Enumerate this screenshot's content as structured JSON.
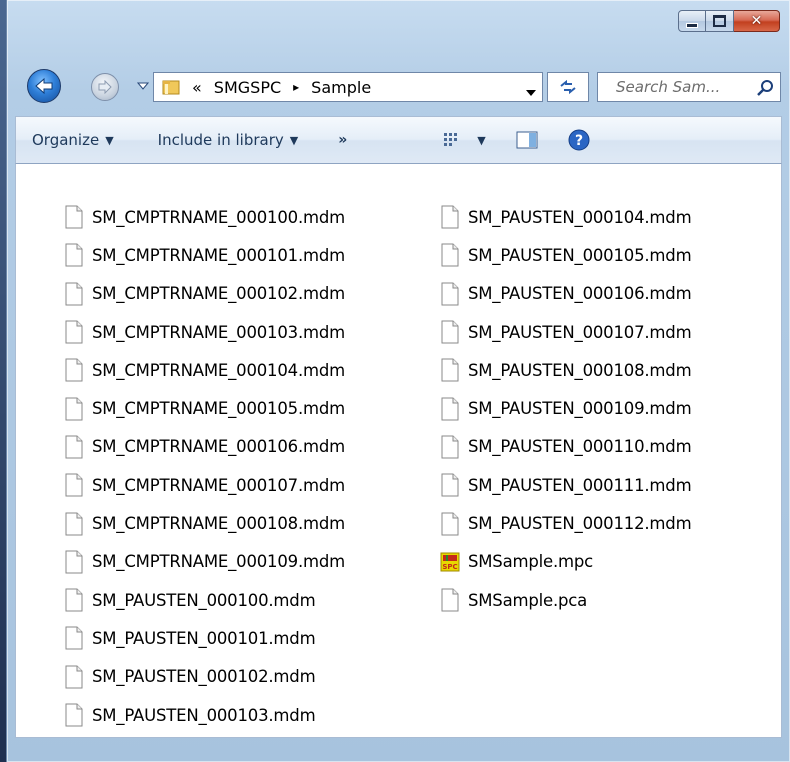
{
  "window": {
    "caption_buttons": {
      "minimize": "minimize-icon",
      "maximize": "maximize-icon",
      "close": "close-icon"
    },
    "close_color": "#c2401f"
  },
  "address_bar": {
    "chevron": "«",
    "crumbs": [
      "SMGSPC",
      "Sample"
    ],
    "separator": "▸"
  },
  "search": {
    "placeholder": "Search Sam..."
  },
  "toolbar": {
    "organize_label": "Organize",
    "include_label": "Include in library",
    "more_label": "»"
  },
  "files": {
    "column1": [
      {
        "name": "SM_CMPTRNAME_000100.mdm",
        "icon": "document-icon"
      },
      {
        "name": "SM_CMPTRNAME_000101.mdm",
        "icon": "document-icon"
      },
      {
        "name": "SM_CMPTRNAME_000102.mdm",
        "icon": "document-icon"
      },
      {
        "name": "SM_CMPTRNAME_000103.mdm",
        "icon": "document-icon"
      },
      {
        "name": "SM_CMPTRNAME_000104.mdm",
        "icon": "document-icon"
      },
      {
        "name": "SM_CMPTRNAME_000105.mdm",
        "icon": "document-icon"
      },
      {
        "name": "SM_CMPTRNAME_000106.mdm",
        "icon": "document-icon"
      },
      {
        "name": "SM_CMPTRNAME_000107.mdm",
        "icon": "document-icon"
      },
      {
        "name": "SM_CMPTRNAME_000108.mdm",
        "icon": "document-icon"
      },
      {
        "name": "SM_CMPTRNAME_000109.mdm",
        "icon": "document-icon"
      },
      {
        "name": "SM_PAUSTEN_000100.mdm",
        "icon": "document-icon"
      },
      {
        "name": "SM_PAUSTEN_000101.mdm",
        "icon": "document-icon"
      },
      {
        "name": "SM_PAUSTEN_000102.mdm",
        "icon": "document-icon"
      },
      {
        "name": "SM_PAUSTEN_000103.mdm",
        "icon": "document-icon"
      }
    ],
    "column2": [
      {
        "name": "SM_PAUSTEN_000104.mdm",
        "icon": "document-icon"
      },
      {
        "name": "SM_PAUSTEN_000105.mdm",
        "icon": "document-icon"
      },
      {
        "name": "SM_PAUSTEN_000106.mdm",
        "icon": "document-icon"
      },
      {
        "name": "SM_PAUSTEN_000107.mdm",
        "icon": "document-icon"
      },
      {
        "name": "SM_PAUSTEN_000108.mdm",
        "icon": "document-icon"
      },
      {
        "name": "SM_PAUSTEN_000109.mdm",
        "icon": "document-icon"
      },
      {
        "name": "SM_PAUSTEN_000110.mdm",
        "icon": "document-icon"
      },
      {
        "name": "SM_PAUSTEN_000111.mdm",
        "icon": "document-icon"
      },
      {
        "name": "SM_PAUSTEN_000112.mdm",
        "icon": "document-icon"
      },
      {
        "name": "SMSample.mpc",
        "icon": "spc-app-icon",
        "icon_text": "SPC"
      },
      {
        "name": "SMSample.pca",
        "icon": "document-icon"
      }
    ]
  }
}
